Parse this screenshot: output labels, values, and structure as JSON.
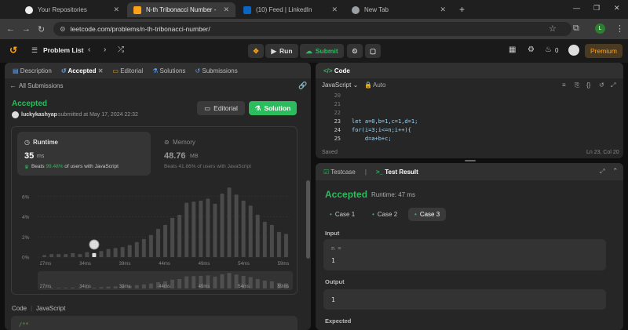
{
  "browser": {
    "tabs": [
      {
        "title": "Your Repositories",
        "active": false,
        "icon": "github-icon"
      },
      {
        "title": "N-th Tribonacci Number - Leet",
        "active": true,
        "icon": "leetcode-icon"
      },
      {
        "title": "(10) Feed | LinkedIn",
        "active": false,
        "icon": "linkedin-icon"
      },
      {
        "title": "New Tab",
        "active": false,
        "icon": "chrome-icon"
      }
    ],
    "url": "leetcode.com/problems/n-th-tribonacci-number/",
    "profile_initial": "L"
  },
  "toolbar": {
    "problem_list": "Problem List",
    "run": "Run",
    "submit": "Submit",
    "coins": "0",
    "premium": "Premium"
  },
  "left_tabs": {
    "description": "Description",
    "accepted": "Accepted",
    "editorial": "Editorial",
    "solutions": "Solutions",
    "submissions": "Submissions"
  },
  "submission": {
    "back": "All Submissions",
    "status": "Accepted",
    "user": "luckykashyap",
    "submitted_at": "submitted at May 17, 2024 22:32",
    "editorial_btn": "Editorial",
    "solution_btn": "Solution",
    "runtime_label": "Runtime",
    "runtime_value": "35",
    "runtime_unit": "ms",
    "runtime_beats_prefix": "Beats",
    "runtime_beats_pct": "99.48%",
    "runtime_beats_suffix": "of users with JavaScript",
    "memory_label": "Memory",
    "memory_value": "48.76",
    "memory_unit": "MB",
    "memory_beats": "Beats 41.86% of users with JavaScript",
    "code_label": "Code",
    "lang_label": "JavaScript",
    "code_first_line": "/**"
  },
  "chart_data": {
    "type": "bar",
    "y_ticks": [
      "6%",
      "4%",
      "2%",
      "0%"
    ],
    "ylim": [
      0,
      7
    ],
    "x_ticks": [
      "27ms",
      "34ms",
      "39ms",
      "44ms",
      "49ms",
      "54ms",
      "59ms"
    ],
    "values": [
      0.2,
      0.3,
      0.3,
      0.3,
      0.4,
      0.3,
      0.5,
      0.4,
      0.6,
      0.8,
      0.9,
      1.0,
      1.2,
      1.5,
      1.8,
      2.2,
      2.8,
      3.2,
      3.9,
      4.2,
      5.4,
      5.5,
      5.6,
      5.8,
      5.3,
      6.3,
      6.9,
      6.2,
      5.6,
      5.1,
      4.2,
      3.5,
      3.2,
      2.5,
      2.3
    ],
    "user_bar_index": 7
  },
  "code_panel": {
    "title": "Code",
    "lang": "JavaScript",
    "auto": "Auto",
    "lines": [
      {
        "n": "20",
        "t": ""
      },
      {
        "n": "21",
        "t": ""
      },
      {
        "n": "22",
        "t": ""
      },
      {
        "n": "23",
        "t": "let a=0,b=1,c=1,d=1;"
      },
      {
        "n": "24",
        "t": "for(i=3;i<=n;i++){"
      },
      {
        "n": "25",
        "t": "    d=a+b+c;"
      }
    ],
    "saved": "Saved",
    "position": "Ln 23, Col 20"
  },
  "result_panel": {
    "testcase_tab": "Testcase",
    "result_tab": "Test Result",
    "status": "Accepted",
    "runtime": "Runtime: 47 ms",
    "cases": [
      "Case 1",
      "Case 2",
      "Case 3"
    ],
    "input_label": "Input",
    "input_var": "n =",
    "input_val": "1",
    "output_label": "Output",
    "output_val": "1",
    "expected_label": "Expected"
  },
  "colors": {
    "accent_green": "#2cbb5d",
    "premium": "#ffa116",
    "bar": "#4a4a4a"
  }
}
